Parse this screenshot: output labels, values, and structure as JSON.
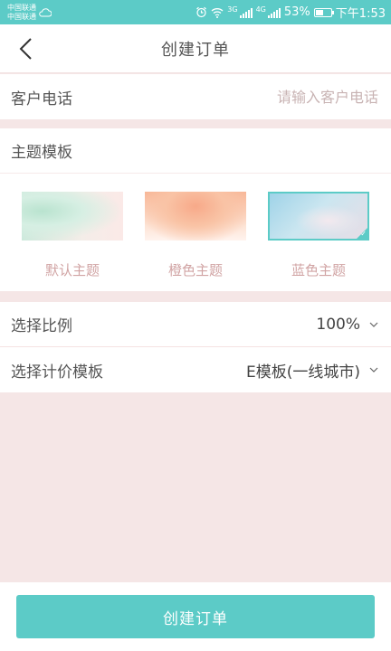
{
  "status_bar": {
    "carrier_1": "中国联通",
    "carrier_2": "中国联通",
    "network_1": "3G",
    "network_2": "4G",
    "battery": "53%",
    "battery_level": 0.53,
    "time": "下午1:53"
  },
  "header": {
    "title": "创建订单"
  },
  "phone": {
    "label": "客户电话",
    "placeholder": "请输入客户电话",
    "value": ""
  },
  "theme": {
    "label": "主题模板",
    "items": [
      {
        "label": "默认主题",
        "selected": false
      },
      {
        "label": "橙色主题",
        "selected": false
      },
      {
        "label": "蓝色主题",
        "selected": true
      }
    ]
  },
  "ratio": {
    "label": "选择比例",
    "value": "100%"
  },
  "pricing": {
    "label": "选择计价模板",
    "value": "E模板(一线城市)"
  },
  "submit": {
    "label": "创建订单"
  },
  "colors": {
    "accent": "#5ccbc7",
    "background": "#f5e6e6",
    "theme_label": "#d1a4a4"
  }
}
